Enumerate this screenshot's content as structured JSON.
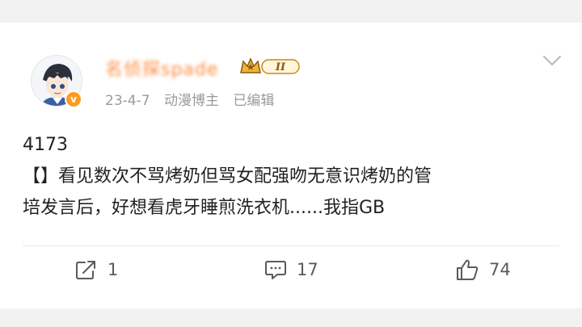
{
  "post": {
    "username": "名侦探spade",
    "vip_level": "II",
    "verified_badge": "v",
    "meta": {
      "date": "23-4-7",
      "role": "动漫博主",
      "edited": "已编辑"
    },
    "content": {
      "line1": "4173",
      "line2": "【】看见数次不骂烤奶但骂女配强吻无意识烤奶的管",
      "line3": "培发言后，好想看虎牙睡煎洗衣机......我指GB"
    },
    "actions": {
      "share_count": "1",
      "comment_count": "17",
      "like_count": "74"
    }
  },
  "colors": {
    "username": "#ff8a3d",
    "badge_gold": "#f2b233",
    "verified": "#ff9a1f",
    "meta_text": "#9a9a9a"
  },
  "icons": {
    "share": "share-icon",
    "comment": "comment-icon",
    "like": "thumbs-up-icon",
    "menu": "chevron-down-icon"
  }
}
